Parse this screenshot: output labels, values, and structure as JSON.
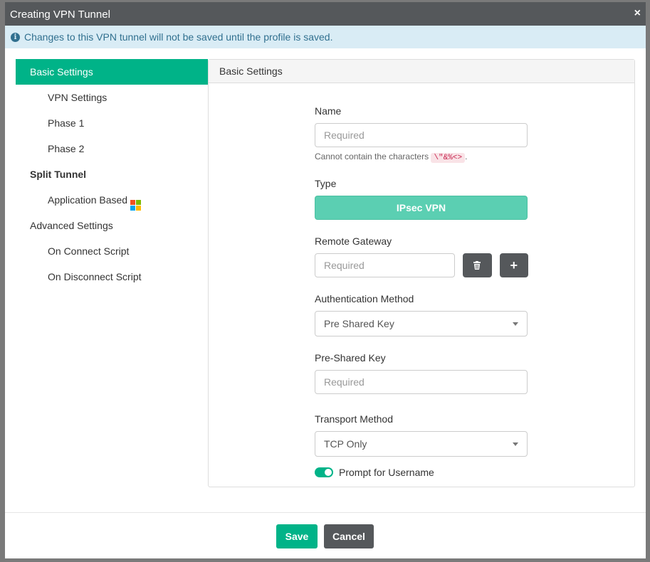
{
  "dialog": {
    "title": "Creating VPN Tunnel",
    "close": "×"
  },
  "info": {
    "text": "Changes to this VPN tunnel will not be saved until the profile is saved.",
    "icon": "i"
  },
  "nav": {
    "items": [
      {
        "label": "Basic Settings"
      },
      {
        "label": "VPN Settings"
      },
      {
        "label": "Phase 1"
      },
      {
        "label": "Phase 2"
      },
      {
        "label": "Split Tunnel"
      },
      {
        "label": "Application Based"
      },
      {
        "label": "Advanced Settings"
      },
      {
        "label": "On Connect Script"
      },
      {
        "label": "On Disconnect Script"
      }
    ]
  },
  "panel": {
    "title": "Basic Settings"
  },
  "form": {
    "name_label": "Name",
    "name_placeholder": "Required",
    "name_help": "Cannot contain the characters",
    "name_chars": "\\\"&%<>",
    "name_help_end": ".",
    "type_label": "Type",
    "type_value": "IPsec VPN",
    "gateway_label": "Remote Gateway",
    "gateway_placeholder": "Required",
    "add": "+",
    "auth_label": "Authentication Method",
    "auth_value": "Pre Shared Key",
    "psk_label": "Pre-Shared Key",
    "psk_placeholder": "Required",
    "transport_label": "Transport Method",
    "transport_value": "TCP Only",
    "prompt_label": "Prompt for Username",
    "prompt_enabled": true
  },
  "footer": {
    "save": "Save",
    "cancel": "Cancel"
  }
}
